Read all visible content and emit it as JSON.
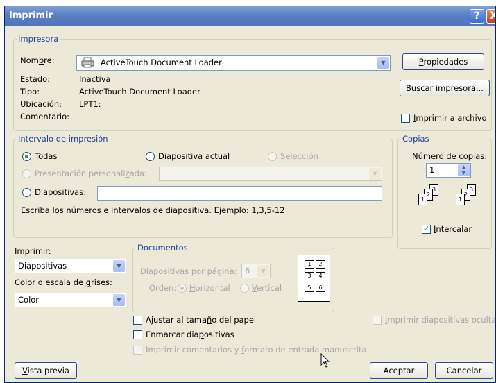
{
  "dialog": {
    "title": "Imprimir",
    "help": "?",
    "close": "X"
  },
  "printer": {
    "group": "Impresora",
    "name_label_pre": "Nom",
    "name_label_u": "b",
    "name_label_post": "re:",
    "name_value": "ActiveTouch Document Loader",
    "status_label": "Estado:",
    "status_value": "Inactiva",
    "type_label": "Tipo:",
    "type_value": "ActiveTouch Document Loader",
    "location_label": "Ubicación:",
    "location_value": "LPT1:",
    "comment_label": "Comentario:",
    "properties_u": "P",
    "properties_rest": "ropiedades",
    "find_pre": "Bus",
    "find_u": "c",
    "find_post": "ar impresora...",
    "print_to_file_u": "I",
    "print_to_file_rest": "mprimir a archivo",
    "print_to_file_checked": false
  },
  "range": {
    "group": "Intervalo de impresión",
    "all_u": "T",
    "all_rest": "odas",
    "all_selected": true,
    "current_u": "D",
    "current_rest": "iapositiva actual",
    "selection_u": "S",
    "selection_rest": "elección",
    "custom_pre": "Presentación personali",
    "custom_u": "z",
    "custom_post": "ada:",
    "slides_pre": "Diapositiva",
    "slides_u": "s",
    "slides_post": ":",
    "slides_value": "",
    "hint": "Escriba los números e intervalos de diapositiva. Ejemplo: 1,3,5-12"
  },
  "copies": {
    "group": "Copias",
    "count_pre": "Número de copias",
    "count_u": ":",
    "count_value": "1",
    "collate_u": "I",
    "collate_rest": "ntercalar",
    "collate_checked": true
  },
  "print_what": {
    "label_pre": "Impr",
    "label_u": "i",
    "label_post": "mir:",
    "value": "Diapositivas"
  },
  "color": {
    "label_pre": "Color o escala de ",
    "label_u": "g",
    "label_post": "rises:",
    "value": "Color"
  },
  "handouts": {
    "group": "Documentos",
    "per_page_pre": "Di",
    "per_page_u": "a",
    "per_page_post": "positivas por página:",
    "per_page_value": "6",
    "order_label": "Orden:",
    "horizontal_u": "H",
    "horizontal_rest": "orizontal",
    "vertical_u": "V",
    "vertical_rest": "ertical"
  },
  "options": {
    "scale_pre": "Ajustar al tama",
    "scale_u": "ñ",
    "scale_post": "o del papel",
    "frame_pre": "Enmarcar dia",
    "frame_u": "p",
    "frame_post": "ositivas",
    "comments_pre": "Imprimir comentarios y ",
    "comments_u": "f",
    "comments_post": "ormato de entrada manuscrita",
    "hidden_u": "I",
    "hidden_rest": "mprimir diapositivas ocultas"
  },
  "footer": {
    "preview_u": "V",
    "preview_rest": "ista previa",
    "ok": "Aceptar",
    "cancel": "Cancelar"
  }
}
